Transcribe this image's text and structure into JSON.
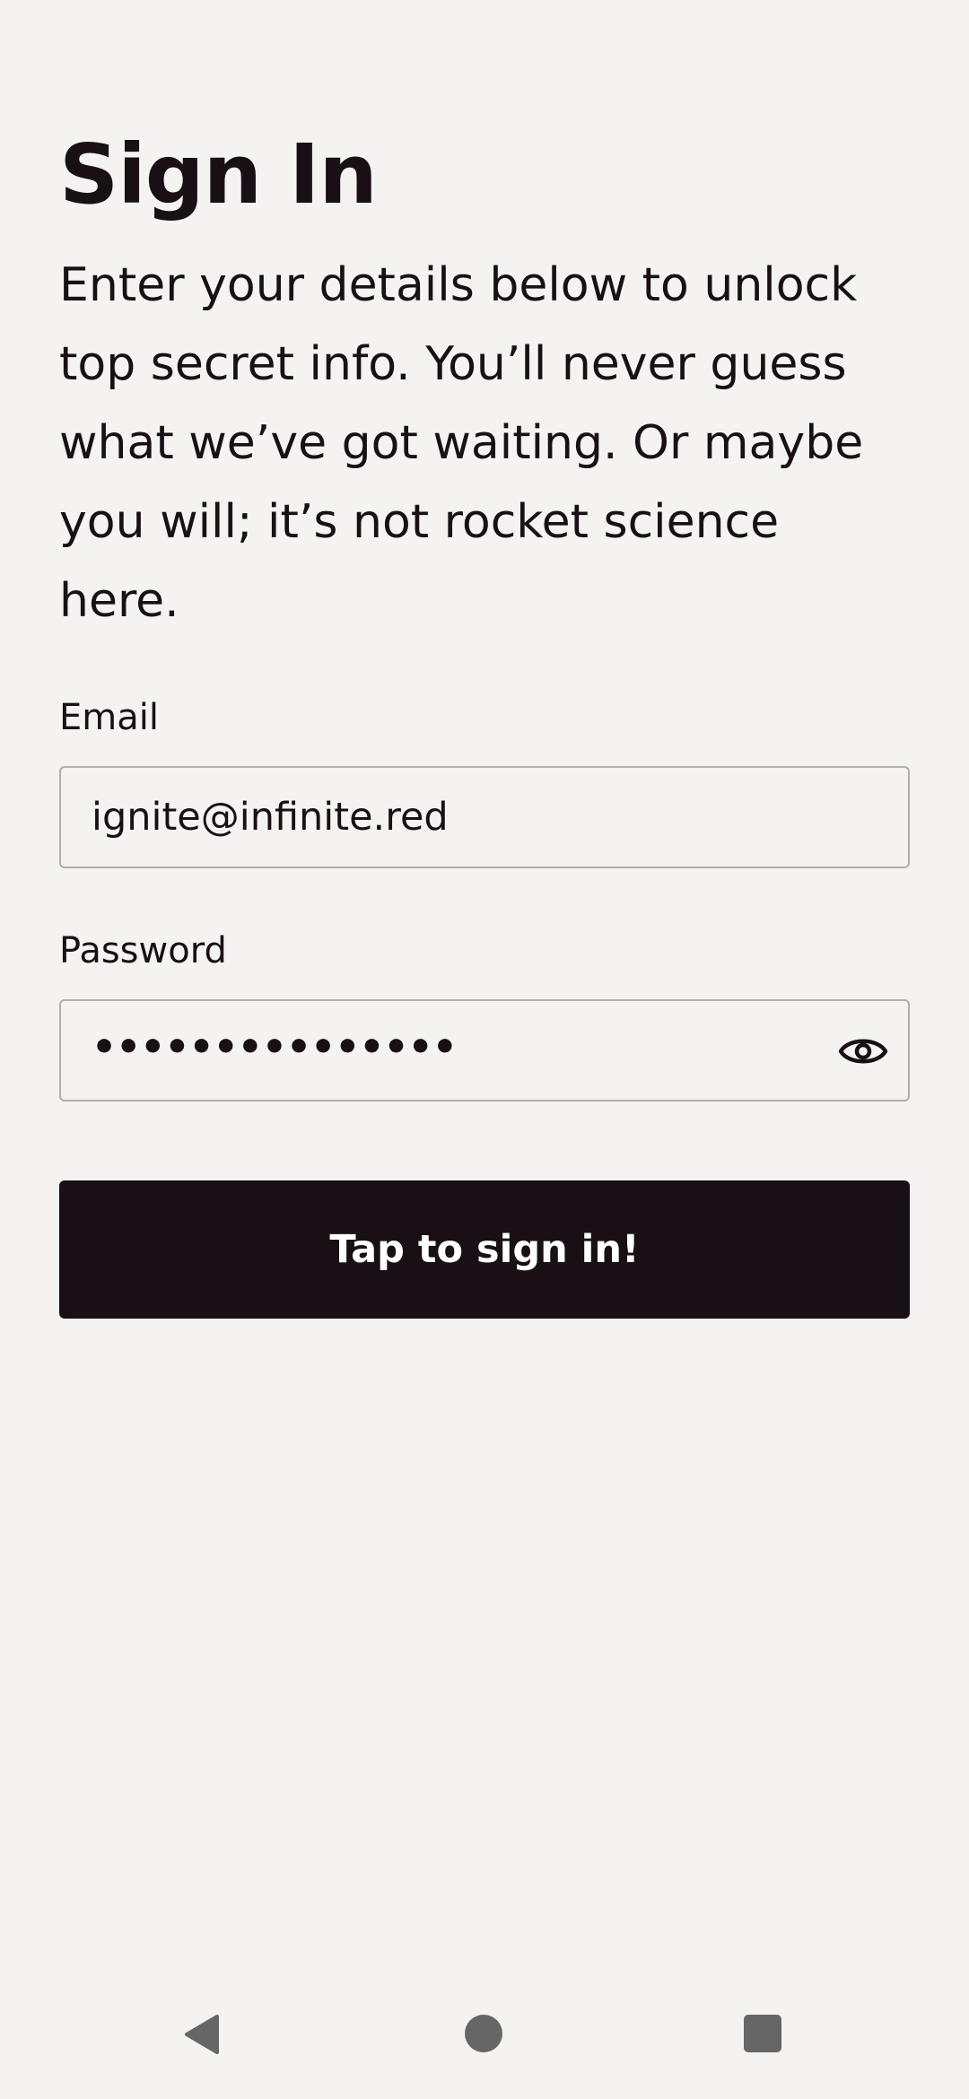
{
  "screen": {
    "title": "Sign In",
    "subtitle": "Enter your details below to unlock top secret info. You’ll never guess what we’ve got waiting. Or maybe you will; it’s not rocket science here."
  },
  "email": {
    "label": "Email",
    "value": "ignite@infinite.red"
  },
  "password": {
    "label": "Password",
    "masked_value": "•••••••••••••••",
    "toggle_icon": "eye-icon"
  },
  "button": {
    "label": "Tap to sign in!"
  },
  "navbar": {
    "back_icon": "back-triangle-icon",
    "home_icon": "home-circle-icon",
    "recents_icon": "recents-square-icon"
  },
  "colors": {
    "background": "#f4f3f1",
    "text": "#191015",
    "border": "#b6acac",
    "button_bg": "#191015",
    "button_text": "#ffffff",
    "nav_icon": "#666666"
  }
}
